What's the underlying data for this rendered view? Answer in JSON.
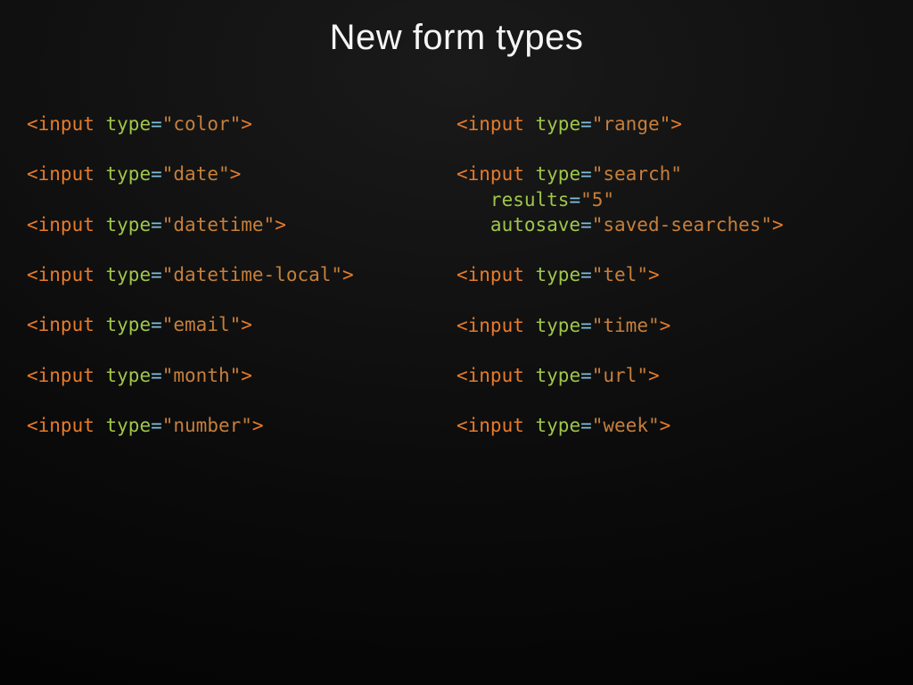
{
  "title": "New form types",
  "left": [
    [
      {
        "kind": "tag",
        "text": "<input"
      },
      {
        "kind": "sp",
        "text": " "
      },
      {
        "kind": "attr",
        "text": "type"
      },
      {
        "kind": "eq",
        "text": "="
      },
      {
        "kind": "string",
        "text": "\"color\""
      },
      {
        "kind": "tag",
        "text": ">"
      }
    ],
    [
      {
        "kind": "tag",
        "text": "<input"
      },
      {
        "kind": "sp",
        "text": " "
      },
      {
        "kind": "attr",
        "text": "type"
      },
      {
        "kind": "eq",
        "text": "="
      },
      {
        "kind": "string",
        "text": "\"date\""
      },
      {
        "kind": "tag",
        "text": ">"
      }
    ],
    [
      {
        "kind": "tag",
        "text": "<input"
      },
      {
        "kind": "sp",
        "text": " "
      },
      {
        "kind": "attr",
        "text": "type"
      },
      {
        "kind": "eq",
        "text": "="
      },
      {
        "kind": "string",
        "text": "\"datetime\""
      },
      {
        "kind": "tag",
        "text": ">"
      }
    ],
    [
      {
        "kind": "tag",
        "text": "<input"
      },
      {
        "kind": "sp",
        "text": " "
      },
      {
        "kind": "attr",
        "text": "type"
      },
      {
        "kind": "eq",
        "text": "="
      },
      {
        "kind": "string",
        "text": "\"datetime-local\""
      },
      {
        "kind": "tag",
        "text": ">"
      }
    ],
    [
      {
        "kind": "tag",
        "text": "<input"
      },
      {
        "kind": "sp",
        "text": " "
      },
      {
        "kind": "attr",
        "text": "type"
      },
      {
        "kind": "eq",
        "text": "="
      },
      {
        "kind": "string",
        "text": "\"email\""
      },
      {
        "kind": "tag",
        "text": ">"
      }
    ],
    [
      {
        "kind": "tag",
        "text": "<input"
      },
      {
        "kind": "sp",
        "text": " "
      },
      {
        "kind": "attr",
        "text": "type"
      },
      {
        "kind": "eq",
        "text": "="
      },
      {
        "kind": "string",
        "text": "\"month\""
      },
      {
        "kind": "tag",
        "text": ">"
      }
    ],
    [
      {
        "kind": "tag",
        "text": "<input"
      },
      {
        "kind": "sp",
        "text": " "
      },
      {
        "kind": "attr",
        "text": "type"
      },
      {
        "kind": "eq",
        "text": "="
      },
      {
        "kind": "string",
        "text": "\"number\""
      },
      {
        "kind": "tag",
        "text": ">"
      }
    ]
  ],
  "right": [
    [
      {
        "kind": "tag",
        "text": "<input"
      },
      {
        "kind": "sp",
        "text": " "
      },
      {
        "kind": "attr",
        "text": "type"
      },
      {
        "kind": "eq",
        "text": "="
      },
      {
        "kind": "string",
        "text": "\"range\""
      },
      {
        "kind": "tag",
        "text": ">"
      }
    ],
    [
      {
        "kind": "tag",
        "text": "<input"
      },
      {
        "kind": "sp",
        "text": " "
      },
      {
        "kind": "attr",
        "text": "type"
      },
      {
        "kind": "eq",
        "text": "="
      },
      {
        "kind": "string",
        "text": "\"search\""
      },
      {
        "kind": "br"
      },
      {
        "kind": "indent"
      },
      {
        "kind": "attr",
        "text": "results"
      },
      {
        "kind": "eq",
        "text": "="
      },
      {
        "kind": "string",
        "text": "\"5\""
      },
      {
        "kind": "br"
      },
      {
        "kind": "indent"
      },
      {
        "kind": "attr",
        "text": "autosave"
      },
      {
        "kind": "eq",
        "text": "="
      },
      {
        "kind": "string",
        "text": "\"saved-searches\""
      },
      {
        "kind": "tag",
        "text": ">"
      }
    ],
    [
      {
        "kind": "tag",
        "text": "<input"
      },
      {
        "kind": "sp",
        "text": " "
      },
      {
        "kind": "attr",
        "text": "type"
      },
      {
        "kind": "eq",
        "text": "="
      },
      {
        "kind": "string",
        "text": "\"tel\""
      },
      {
        "kind": "tag",
        "text": ">"
      }
    ],
    [
      {
        "kind": "tag",
        "text": "<input"
      },
      {
        "kind": "sp",
        "text": " "
      },
      {
        "kind": "attr",
        "text": "type"
      },
      {
        "kind": "eq",
        "text": "="
      },
      {
        "kind": "string",
        "text": "\"time\""
      },
      {
        "kind": "tag",
        "text": ">"
      }
    ],
    [
      {
        "kind": "tag",
        "text": "<input"
      },
      {
        "kind": "sp",
        "text": " "
      },
      {
        "kind": "attr",
        "text": "type"
      },
      {
        "kind": "eq",
        "text": "="
      },
      {
        "kind": "string",
        "text": "\"url\""
      },
      {
        "kind": "tag",
        "text": ">"
      }
    ],
    [
      {
        "kind": "tag",
        "text": "<input"
      },
      {
        "kind": "sp",
        "text": " "
      },
      {
        "kind": "attr",
        "text": "type"
      },
      {
        "kind": "eq",
        "text": "="
      },
      {
        "kind": "string",
        "text": "\"week\""
      },
      {
        "kind": "tag",
        "text": ">"
      }
    ]
  ]
}
